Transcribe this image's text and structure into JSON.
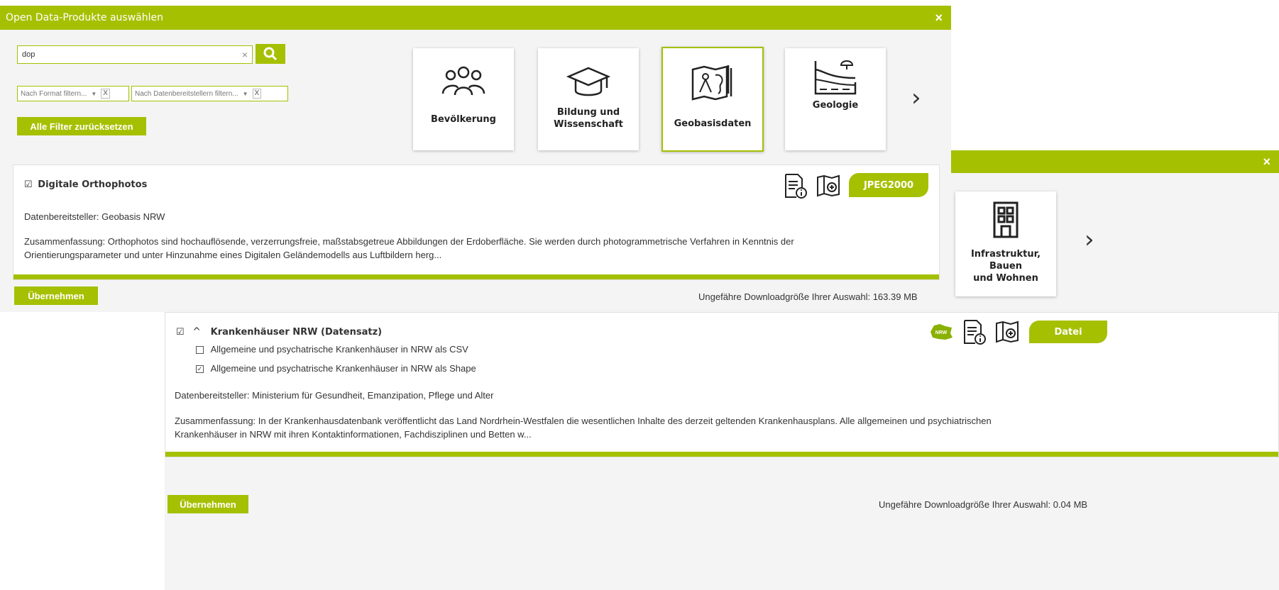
{
  "dialog1": {
    "title": "Open Data-Produkte auswählen",
    "close": "×",
    "search": {
      "value": "dop",
      "clear": "×"
    },
    "filters": [
      {
        "label": "Nach Format filtern...",
        "caret": "▼",
        "clear": "X"
      },
      {
        "label": "Nach Datenbereitstellern filtern...",
        "caret": "▼",
        "clear": "X"
      }
    ],
    "reset_button": "Alle Filter zurücksetzen",
    "categories": [
      {
        "label": "Bevölkerung",
        "icon": "people-icon"
      },
      {
        "label": "Bildung und Wissenschaft",
        "icon": "graduation-cap-icon"
      },
      {
        "label": "Geobasisdaten",
        "icon": "map-compass-icon",
        "selected": true
      },
      {
        "label": "Geologie",
        "icon": "geology-icon"
      }
    ],
    "next": "›",
    "result": {
      "checkbox": "☑",
      "title": "Digitale Orthophotos",
      "provider": "Datenbereitsteller: Geobasis NRW",
      "summary_1": "Zusammenfassung: Orthophotos sind hochauflösende, verzerrungsfreie, maßstabsgetreue Abbildungen der Erdoberfläche. Sie werden durch photogrammetrische Verfahren in Kenntnis der",
      "summary_2": "Orientierungsparameter und unter Hinzunahme eines Digitalen Geländemodells aus Luftbildern herg...",
      "format": "JPEG2000"
    },
    "apply_button": "Übernehmen",
    "download_size": "Ungefähre Downloadgröße Ihrer Auswahl: 163.39 MB"
  },
  "dialog2": {
    "close": "×",
    "category": {
      "label_1": "Infrastruktur, Bauen",
      "label_2": "und Wohnen",
      "icon": "building-icon"
    },
    "next": "›",
    "result": {
      "checkbox": "☑",
      "expand": "^",
      "title": "Krankenhäuser NRW (Datensatz)",
      "sub_items": [
        {
          "checked": false,
          "mark": "",
          "label": "Allgemeine und psychatrische Krankenhäuser in NRW als CSV"
        },
        {
          "checked": true,
          "mark": "✓",
          "label": "Allgemeine und psychatrische Krankenhäuser in NRW als Shape"
        }
      ],
      "provider": "Datenbereitsteller: Ministerium für Gesundheit, Emanzipation, Pflege und Alter",
      "summary_1": "Zusammenfassung: In der Krankenhausdatenbank veröffentlicht das Land Nordrhein-Westfalen die wesentlichen Inhalte des derzeit geltenden Krankenhausplans. Alle allgemeinen und psychiatrischen",
      "summary_2": "Krankenhäuser in NRW mit ihren Kontaktinformationen, Fachdisziplinen und Betten w...",
      "nrw_logo": "NRW",
      "format": "Datei"
    },
    "apply_button": "Übernehmen",
    "download_size": "Ungefähre Downloadgröße Ihrer Auswahl: 0.04 MB"
  },
  "colors": {
    "accent": "#a5c000",
    "panel": "#f4f4f4",
    "text": "#333333"
  }
}
